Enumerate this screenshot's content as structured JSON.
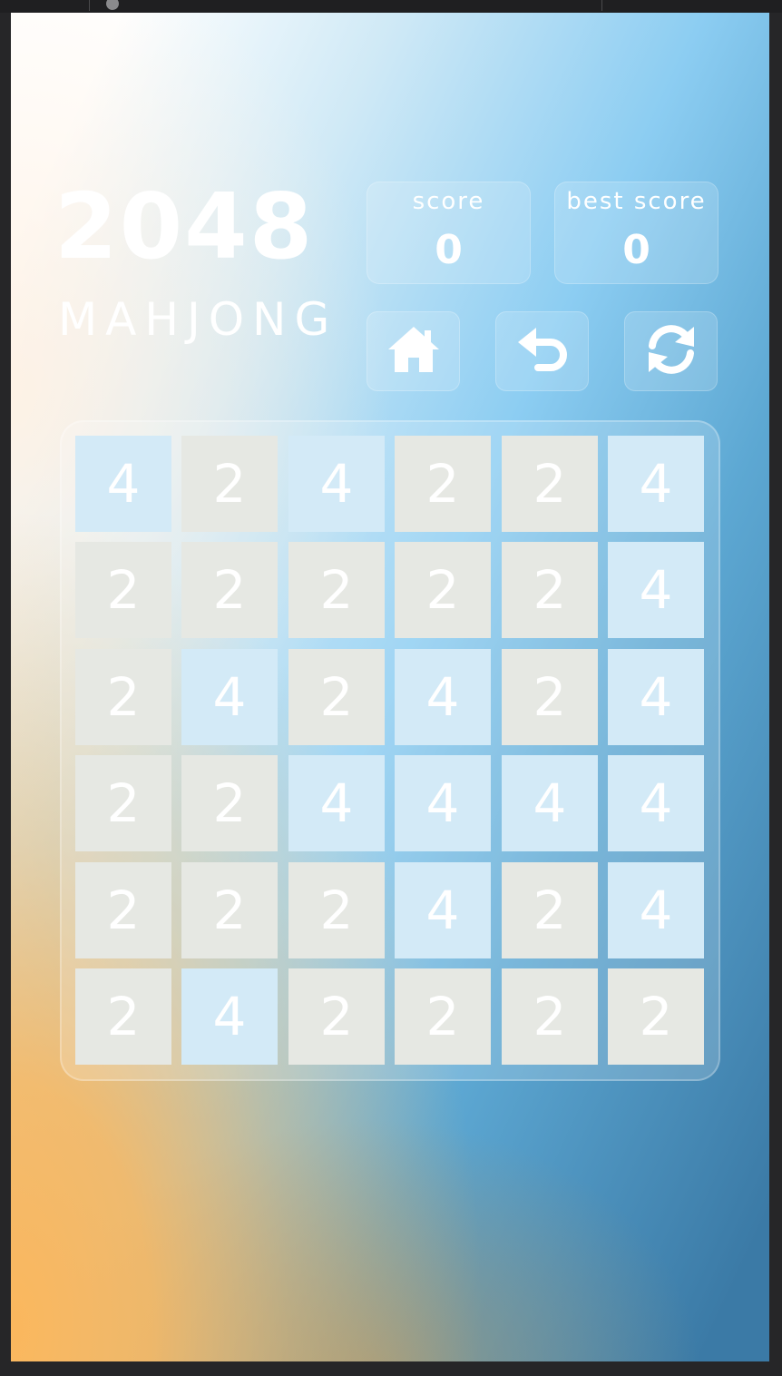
{
  "game": {
    "title": "2048",
    "subtitle": "MAHJONG",
    "score": {
      "label": "score",
      "value": "0"
    },
    "best_score": {
      "label": "best score",
      "value": "0"
    },
    "buttons": [
      {
        "name": "home-button",
        "icon": "home-icon"
      },
      {
        "name": "undo-button",
        "icon": "undo-icon"
      },
      {
        "name": "restart-button",
        "icon": "restart-icon"
      }
    ],
    "tile_colors": {
      "2": "#e6e8e3",
      "4": "#d3eaf7"
    },
    "board": [
      [
        "4",
        "2",
        "4",
        "2",
        "2",
        "4"
      ],
      [
        "2",
        "2",
        "2",
        "2",
        "2",
        "4"
      ],
      [
        "2",
        "4",
        "2",
        "4",
        "2",
        "4"
      ],
      [
        "2",
        "2",
        "4",
        "4",
        "4",
        "4"
      ],
      [
        "2",
        "2",
        "2",
        "4",
        "2",
        "4"
      ],
      [
        "2",
        "4",
        "2",
        "2",
        "2",
        "2"
      ]
    ]
  }
}
